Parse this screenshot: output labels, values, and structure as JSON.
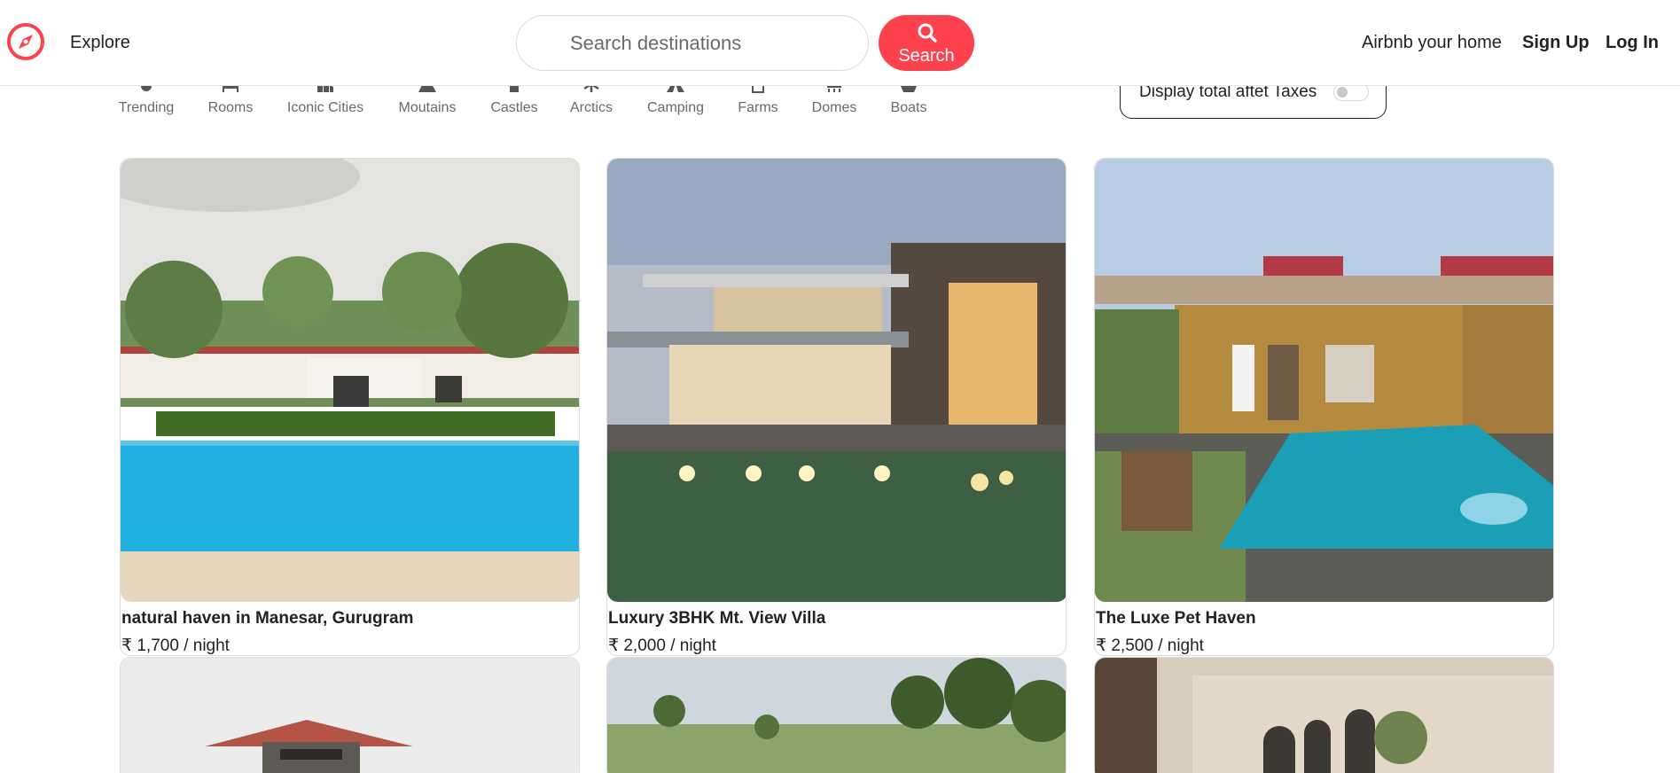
{
  "brand": {
    "accent": "#fe424d",
    "logo_icon": "compass-icon"
  },
  "nav": {
    "explore": "Explore",
    "search_placeholder": "Search destinations",
    "search_label": "Search",
    "host": "Airbnb your home",
    "signup": "Sign Up",
    "login": "Log In"
  },
  "filters": [
    {
      "label": "Trending",
      "icon": "fire-icon"
    },
    {
      "label": "Rooms",
      "icon": "bed-icon"
    },
    {
      "label": "Iconic Cities",
      "icon": "city-icon"
    },
    {
      "label": "Moutains",
      "icon": "mountain-icon"
    },
    {
      "label": "Castles",
      "icon": "castle-icon"
    },
    {
      "label": "Arctics",
      "icon": "snowflake-icon"
    },
    {
      "label": "Camping",
      "icon": "tent-icon"
    },
    {
      "label": "Farms",
      "icon": "cow-icon"
    },
    {
      "label": "Domes",
      "icon": "dome-icon"
    },
    {
      "label": "Boats",
      "icon": "ship-icon"
    }
  ],
  "tax_toggle": {
    "label": "Display total aftet Taxes",
    "on": false
  },
  "listings": [
    {
      "title": "natural haven in Manesar, Gurugram",
      "price": "₹ 1,700 / night"
    },
    {
      "title": "Luxury 3BHK Mt. View Villa",
      "price": "₹ 2,000 / night"
    },
    {
      "title": "The Luxe Pet Haven",
      "price": "₹ 2,500 / night"
    },
    {
      "title": "",
      "price": ""
    },
    {
      "title": "",
      "price": ""
    },
    {
      "title": "",
      "price": ""
    }
  ]
}
